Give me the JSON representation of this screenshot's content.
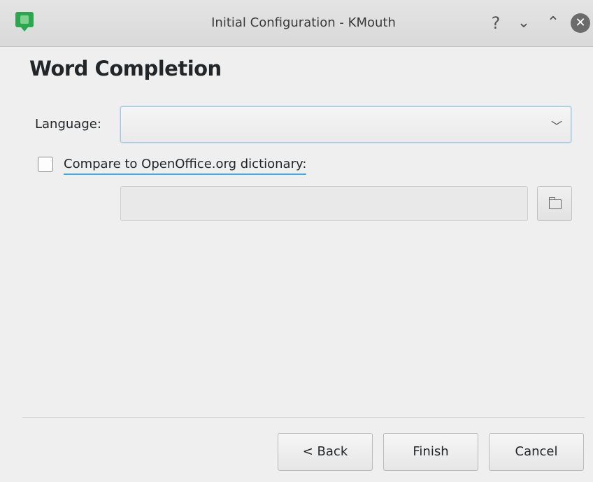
{
  "window": {
    "title": "Initial Configuration - KMouth",
    "help_glyph": "?",
    "minimize_glyph": "⌄",
    "maximize_glyph": "⌃",
    "close_glyph": "✕"
  },
  "page": {
    "heading": "Word Completion",
    "language_label": "Language:",
    "language_value": "",
    "compare_label": "Compare to OpenOffice.org dictionary:",
    "compare_checked": false,
    "dictionary_path": ""
  },
  "buttons": {
    "back": "< Back",
    "finish": "Finish",
    "cancel": "Cancel"
  },
  "icons": {
    "app": "kmouth-icon",
    "combo_arrow": "chevron-down-icon",
    "browse": "folder-icon"
  },
  "colors": {
    "accent": "#3daee9",
    "app_icon": "#2ea64f"
  }
}
